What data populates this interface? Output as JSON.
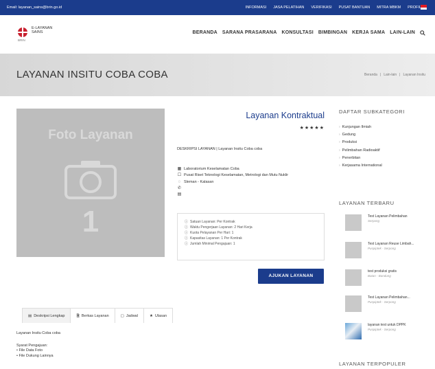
{
  "topbar": {
    "email": "Email: layanan_sains@brin.go.id",
    "nav": [
      "INFORMASI",
      "JASA PELATIHAN",
      "VERIFIKASI",
      "PUSAT BANTUAN",
      "MITRA MBKM",
      "PROFIL"
    ],
    "flag_colors": [
      "#e31b23",
      "#ffffff"
    ]
  },
  "header": {
    "logo_line1": "E-LAYANAN",
    "logo_line2": "SAINS",
    "logo_line3": "BRIN",
    "nav": [
      "BERANDA",
      "SARANA PRASARANA",
      "KONSULTASI",
      "BIMBINGAN",
      "KERJA SAMA",
      "LAIN-LAIN"
    ],
    "search_icon": "search-icon"
  },
  "banner": {
    "title": "LAYANAN INSITU COBA COBA",
    "breadcrumb": [
      "Beranda",
      "Lain-lain",
      "Layanan Insitu"
    ]
  },
  "photo": {
    "caption": "Foto Layanan",
    "number": "1"
  },
  "service": {
    "title": "Layanan Kontraktual",
    "stars": "★★★★★",
    "description": "DESKRIPSI LAYANAN | Layanan Insitu Coba coba",
    "lab": "Laboratorium Keselamatan Coba",
    "center": "Pusat Riset Teknologi Keselamatan, Metrologi dan Mutu Nuklir",
    "location": "Sleman - Kalasan",
    "phone": "",
    "fax": ""
  },
  "info": [
    "Satuan Layanan: Per Kontrak",
    "Waktu Pengerjaan Layanan: 2 Hari Kerja",
    "Kuota Pelayanan Per Hari: 1",
    "Kapasitas Layanan: 1 Per Kontrak",
    "Jumlah Minimal Pengajuan: 1"
  ],
  "actions": {
    "submit": "AJUKAN LAYANAN"
  },
  "tabs": [
    {
      "label": "Deskripsi Lengkap",
      "icon": "list-icon"
    },
    {
      "label": "Berkas Layanan",
      "icon": "file-icon"
    },
    {
      "label": "Jadwal",
      "icon": "calendar-icon"
    },
    {
      "label": "Ulasan",
      "icon": "star-icon"
    }
  ],
  "tab_content": {
    "summary": "Layanan Insitu Coba coba",
    "req_title": "Syarat Pengajuan:",
    "req_items": [
      "File Data Foto",
      "File Dukung Lainnya"
    ]
  },
  "sidebar": {
    "subcat_heading": "DAFTAR SUBKATEGORI",
    "subcats": [
      "Kunjungan Ilmiah",
      "Gedung",
      "Produksi",
      "Pelimbahan Radioaktif",
      "Penerbitan",
      "Kerjasama International"
    ],
    "latest_heading": "LAYANAN TERBARU",
    "latest": [
      {
        "title": "Test Layanan Pelimbahan",
        "sub": "Serpong"
      },
      {
        "title": "Test Layanan Reuse Limbah...",
        "sub": "Puspiptek - Serpong"
      },
      {
        "title": "test produksi gratis",
        "sub": "Batan - Bandung"
      },
      {
        "title": "Test Layanan Pelimbahan...",
        "sub": "Puspiptek - Serpong"
      },
      {
        "title": "layanan test untuk DPPK",
        "sub": "Puspiptek - Serpong"
      }
    ],
    "popular_heading": "LAYANAN TERPOPULER"
  }
}
